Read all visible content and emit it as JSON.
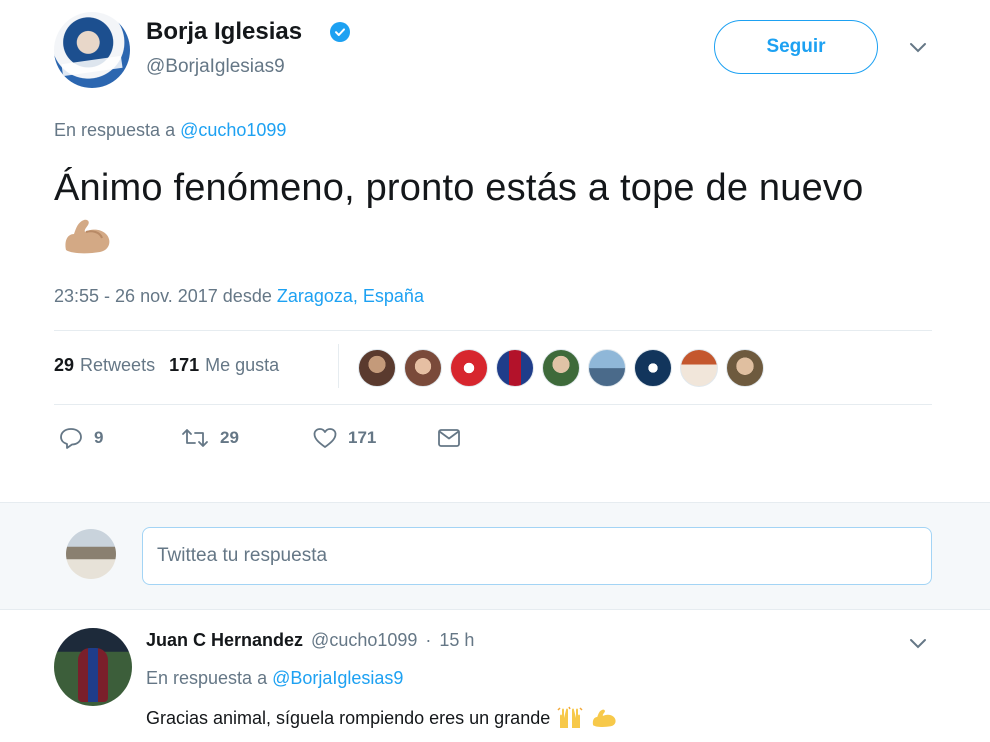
{
  "tweet": {
    "author": {
      "name": "Borja Iglesias",
      "handle": "@BorjaIglesias9",
      "verified": true
    },
    "follow_label": "Seguir",
    "reply_prefix": "En respuesta a",
    "reply_mention": "@cucho1099",
    "text": "Ánimo fenómeno, pronto estás a tope de nuevo",
    "emoji": "flexed-biceps",
    "timestamp_prefix": "23:55 - 26 nov. 2017 desde",
    "location": "Zaragoza, España",
    "retweets_count": "29",
    "retweets_label": "Retweets",
    "likes_count": "171",
    "likes_label": "Me gusta",
    "liker_avatars": [
      "liker-1",
      "liker-2",
      "liker-3",
      "liker-4",
      "liker-5",
      "liker-6",
      "liker-7",
      "liker-8",
      "liker-9"
    ],
    "actions": {
      "reply_count": "9",
      "retweet_count": "29",
      "like_count": "171"
    }
  },
  "reply_box": {
    "placeholder": "Twittea tu respuesta"
  },
  "reply": {
    "author": {
      "name": "Juan C Hernandez",
      "handle": "@cucho1099",
      "time": "15 h"
    },
    "reply_prefix": "En respuesta a",
    "reply_mention": "@BorjaIglesias9",
    "text": "Gracias animal, síguela rompiendo eres un grande",
    "emojis": [
      "raising-hands",
      "flexed-biceps"
    ]
  },
  "colors": {
    "accent": "#1da1f2",
    "muted": "#657786",
    "text": "#14171a",
    "divider": "#e6ecf0",
    "reply_bg": "#f5f8fa"
  }
}
